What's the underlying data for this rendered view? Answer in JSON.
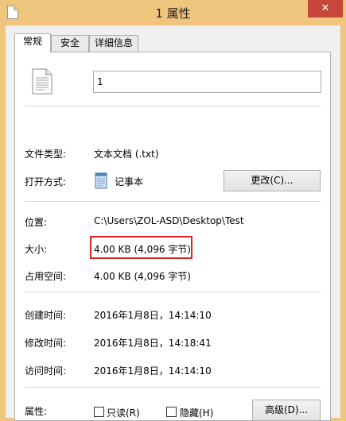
{
  "window": {
    "title": "1 属性",
    "close": "✕"
  },
  "tabs": [
    {
      "label": "常规"
    },
    {
      "label": "安全"
    },
    {
      "label": "详细信息"
    }
  ],
  "general": {
    "file_name": "1",
    "file_type_label": "文件类型:",
    "file_type_value": "文本文档 (.txt)",
    "open_with_label": "打开方式:",
    "open_with_value": "记事本",
    "change_button": "更改(C)...",
    "location_label": "位置:",
    "location_value": "C:\\Users\\ZOL-ASD\\Desktop\\Test",
    "size_label": "大小:",
    "size_value": "4.00 KB (4,096 字节)",
    "size_on_disk_label": "占用空间:",
    "size_on_disk_value": "4.00 KB (4,096 字节)",
    "created_label": "创建时间:",
    "created_value": "2016年1月8日，14:14:10",
    "modified_label": "修改时间:",
    "modified_value": "2016年1月8日，14:18:41",
    "accessed_label": "访问时间:",
    "accessed_value": "2016年1月8日，14:14:10",
    "attributes_label": "属性:",
    "readonly_label": "只读(R)",
    "hidden_label": "隐藏(H)",
    "advanced_button": "高级(D)..."
  }
}
